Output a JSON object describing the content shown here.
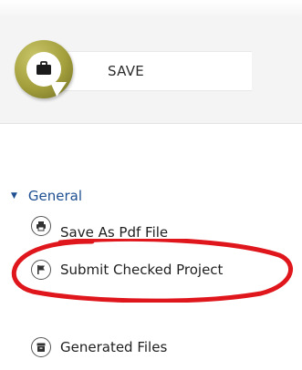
{
  "save": {
    "label": "SAVE",
    "icon": "briefcase-icon",
    "accent_color": "#a39f3c"
  },
  "general": {
    "label": "General",
    "expanded": true,
    "label_color": "#1d4f91",
    "items": [
      {
        "label": "Save As Pdf File",
        "icon": "printer-icon"
      },
      {
        "label": "Submit Checked Project",
        "icon": "flag-icon"
      },
      {
        "label": "Generated Files",
        "icon": "archive-icon"
      }
    ]
  },
  "annotation": {
    "color": "#e0161d"
  }
}
